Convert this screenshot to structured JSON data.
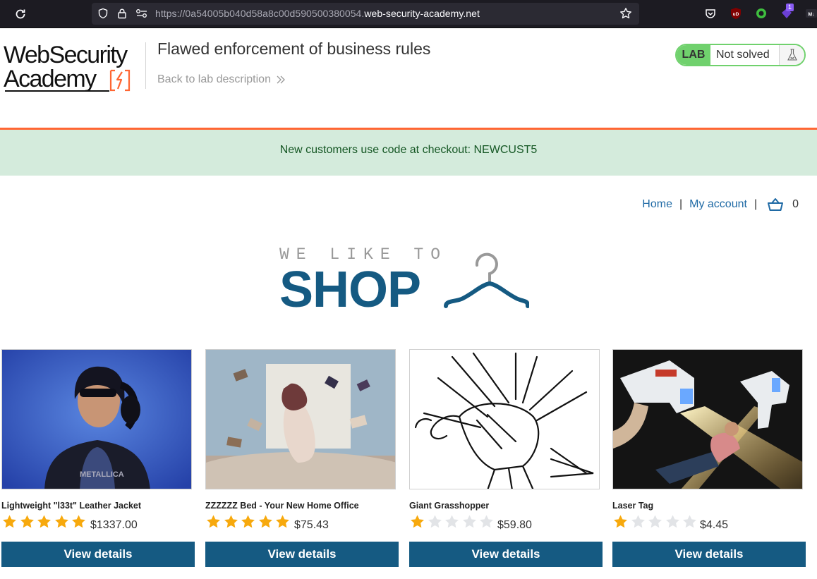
{
  "browser": {
    "url_prefix": "https://0a54005b040d58a8c00d590500380054.",
    "url_domain": "web-security-academy.net",
    "extension_badge": "1"
  },
  "header": {
    "logo_line1": "WebSecurity",
    "logo_line2": "Academy",
    "lab_title": "Flawed enforcement of business rules",
    "back_link": "Back to lab description",
    "lab_label": "LAB",
    "lab_status": "Not solved"
  },
  "notice": {
    "text": "New customers use code at checkout: NEWCUST5"
  },
  "nav": {
    "home": "Home",
    "separator": "|",
    "my_account": "My account",
    "cart_count": "0"
  },
  "hero": {
    "small": "WE LIKE TO",
    "big": "SHOP"
  },
  "products": [
    {
      "name": "Lightweight \"l33t\" Leather Jacket",
      "rating": 5,
      "price": "$1337.00",
      "button": "View details"
    },
    {
      "name": "ZZZZZZ Bed - Your New Home Office",
      "rating": 5,
      "price": "$75.43",
      "button": "View details"
    },
    {
      "name": "Giant Grasshopper",
      "rating": 1,
      "price": "$59.80",
      "button": "View details"
    },
    {
      "name": "Laser Tag",
      "rating": 1,
      "price": "$4.45",
      "button": "View details"
    }
  ],
  "colors": {
    "brand_blue": "#155a82",
    "link_blue": "#1f6aa5",
    "accent_orange": "#ff6633",
    "lab_green": "#70d16d",
    "notice_bg": "#d4ebdc",
    "star_filled": "#f7a90d",
    "star_empty": "#e2e4e7"
  }
}
